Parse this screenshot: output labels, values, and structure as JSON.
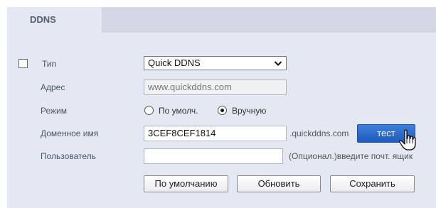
{
  "tabs": [
    {
      "label": "DDNS",
      "active": true
    }
  ],
  "form": {
    "type": {
      "label": "Тип",
      "value": "Quick DDNS",
      "checked": false
    },
    "address": {
      "label": "Адрес",
      "value": "www.quickddns.com"
    },
    "mode": {
      "label": "Режим",
      "options": [
        {
          "label": "По умолч.",
          "selected": false
        },
        {
          "label": "Вручную",
          "selected": true
        }
      ]
    },
    "domain": {
      "label": "Доменное имя",
      "value": "3CEF8CEF1814",
      "suffix": ".quickddns.com",
      "test_button": "тест"
    },
    "user": {
      "label": "Пользователь",
      "value": "",
      "hint": "(Опционал.)введите почт. ящик"
    }
  },
  "buttons": {
    "default": "По умолчанию",
    "refresh": "Обновить",
    "save": "Сохранить"
  },
  "colors": {
    "panel_bg": "#e4e8f2",
    "tabbar_bg": "#d3d8e4",
    "accent": "#2a6bcf"
  },
  "icons": {
    "cursor": "hand-pointer-icon",
    "select_arrow": "chevron-down-icon"
  }
}
